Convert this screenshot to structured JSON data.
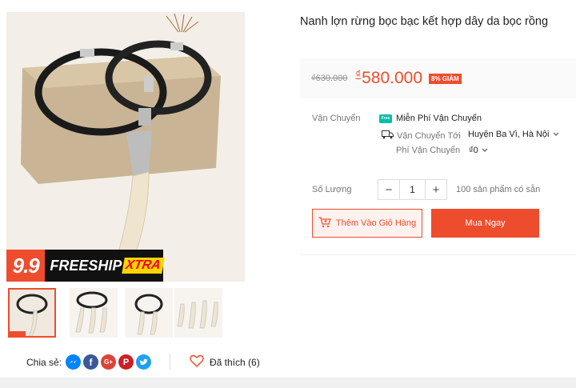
{
  "product": {
    "title": "Nanh lợn rừng bọc bạc kết hợp dây da bọc rồng",
    "old_price": "₫630.000",
    "currency": "₫",
    "price": "580.000",
    "discount_badge": "8% GIẢM"
  },
  "promo": {
    "number": "9.9",
    "text": "FREESHIP",
    "xtra": "XTRA"
  },
  "shipping": {
    "label": "Vận Chuyển",
    "free_badge": "Free",
    "free_text": "Miễn Phí Vận Chuyển",
    "to_label": "Vận Chuyển Tới",
    "to_value": "Huyện Ba Vì, Hà Nội",
    "fee_label": "Phí Vận Chuyển",
    "fee_value": "₫0"
  },
  "quantity": {
    "label": "Số Lượng",
    "value": "1",
    "minus": "−",
    "plus": "+",
    "stock_text": "100 sản phẩm có sẵn"
  },
  "buttons": {
    "add_to_cart": "Thêm Vào Giỏ Hàng",
    "buy_now": "Mua Ngay"
  },
  "share": {
    "label": "Chia sẻ:",
    "icons": [
      "messenger-icon",
      "facebook-icon",
      "google-plus-icon",
      "pinterest-icon",
      "twitter-icon"
    ],
    "facebook_glyph": "f",
    "google_glyph": "G+",
    "pinterest_glyph": "P"
  },
  "likes": {
    "text": "Đã thích (6)"
  },
  "colors": {
    "accent": "#ee4d2d",
    "messenger": "#0084ff",
    "facebook": "#3b5998",
    "google": "#db4437",
    "pinterest": "#cb2027",
    "twitter": "#1da1f2"
  }
}
